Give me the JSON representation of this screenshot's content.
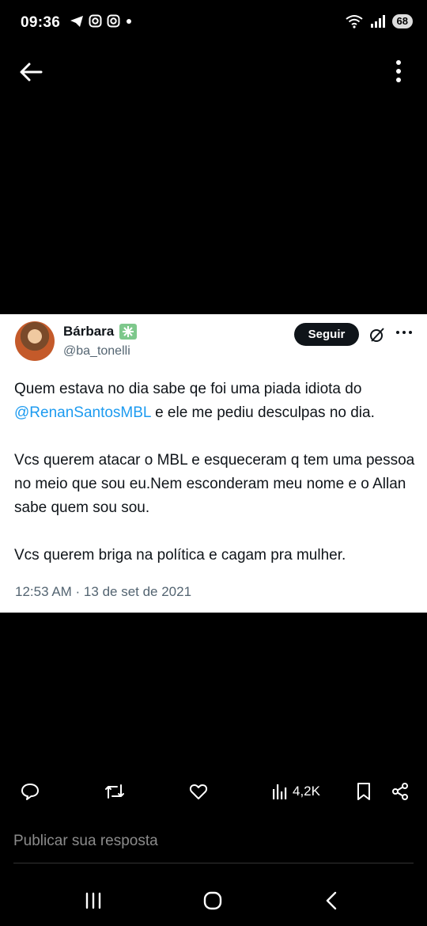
{
  "status": {
    "time": "09:36",
    "battery": "68"
  },
  "tweet": {
    "name": "Bárbara",
    "handle": "@ba_tonelli",
    "follow_label": "Seguir",
    "text_p1_before": "Quem estava no dia sabe qe foi uma piada idiota do ",
    "text_p1_mention": "@RenanSantosMBL",
    "text_p1_after": " e ele me pediu desculpas no dia.",
    "text_p2": "Vcs querem atacar o MBL e  esqueceram q tem uma pessoa no meio que sou eu.Nem esconderam meu nome e o Allan sabe quem sou sou.",
    "text_p3": "Vcs querem briga na política e cagam pra mulher.",
    "timestamp": "12:53 AM · 13 de set de 2021"
  },
  "actions": {
    "views": "4,2K"
  },
  "reply": {
    "placeholder": "Publicar sua resposta"
  },
  "icons": {
    "back": "arrow-left-icon",
    "menu": "more-vertical-icon",
    "reply": "reply-icon",
    "retweet": "retweet-icon",
    "like": "heart-icon",
    "views": "views-icon",
    "bookmark": "bookmark-icon",
    "share": "share-icon"
  }
}
